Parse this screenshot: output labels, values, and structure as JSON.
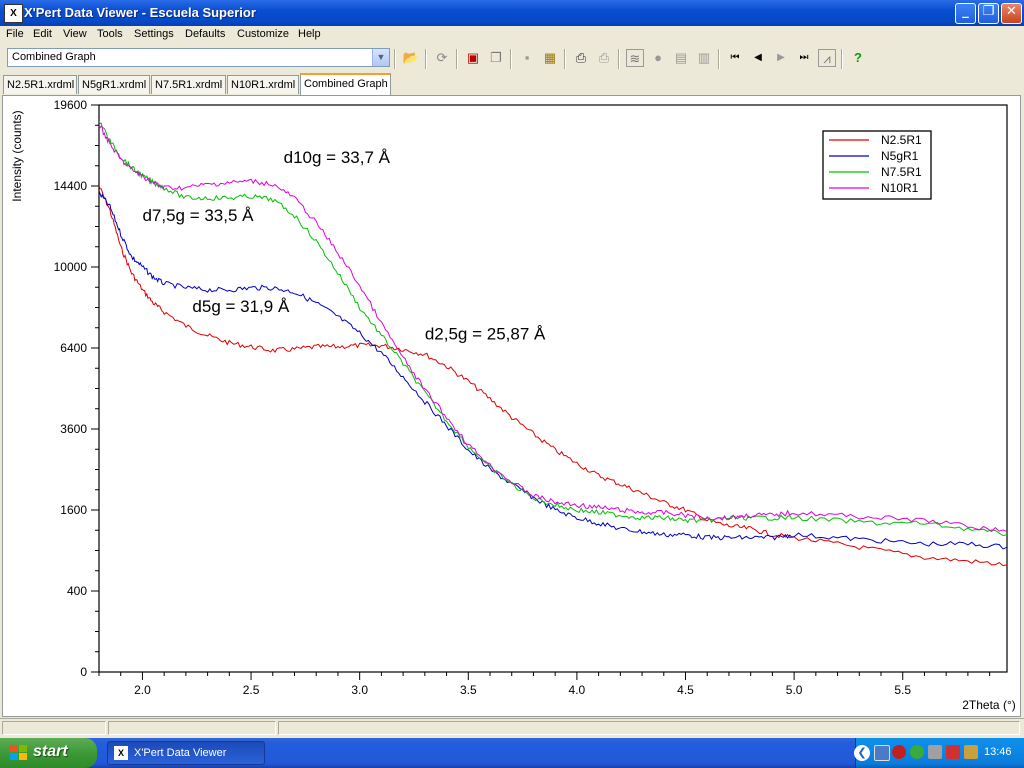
{
  "window": {
    "title": "X'Pert Data Viewer - Escuela Superior",
    "app_icon_label": "X"
  },
  "caption_buttons": {
    "minimize": "_",
    "restore": "❐",
    "close": "✕"
  },
  "menu": [
    "File",
    "Edit",
    "View",
    "Tools",
    "Settings",
    "Defaults",
    "Customize",
    "Help"
  ],
  "toolbar": {
    "graph_select_value": "Combined Graph",
    "icons": [
      "open-folder-icon",
      "refresh-icon",
      "print-preview-icon",
      "copy-icon",
      "camera-icon",
      "clipboard-icon",
      "printer-icon",
      "printer-gray-icon",
      "graph-icon",
      "record-icon",
      "document-icon",
      "page-icon",
      "first-icon",
      "previous-icon",
      "next-icon",
      "last-icon",
      "chart-icon",
      "help-icon"
    ]
  },
  "tabs": [
    {
      "label": "N2.5R1.xrdml",
      "active": false
    },
    {
      "label": "N5gR1.xrdml",
      "active": false
    },
    {
      "label": "N7.5R1.xrdml",
      "active": false
    },
    {
      "label": "N10R1.xrdml",
      "active": false
    },
    {
      "label": "Combined Graph",
      "active": true
    }
  ],
  "chart_data": {
    "type": "line",
    "xlabel": "2Theta (°)",
    "ylabel": "Intensity (counts)",
    "xlim": [
      1.8,
      5.98
    ],
    "y_scale": "sqrt",
    "ylim": [
      0,
      19600
    ],
    "x_ticks": [
      "2.0",
      "2.5",
      "3.0",
      "3.5",
      "4.0",
      "4.5",
      "5.0",
      "5.5"
    ],
    "y_ticks": [
      "0",
      "400",
      "1600",
      "3600",
      "6400",
      "10000",
      "14400",
      "19600"
    ],
    "legend_position": "top-right",
    "grid": false,
    "series": [
      {
        "name": "N2.5R1",
        "color": "#E00000",
        "x": [
          1.8,
          1.85,
          1.9,
          1.95,
          2.0,
          2.05,
          2.1,
          2.2,
          2.3,
          2.4,
          2.5,
          2.6,
          2.7,
          2.8,
          2.9,
          3.0,
          3.1,
          3.2,
          3.3,
          3.4,
          3.5,
          3.6,
          3.7,
          3.8,
          3.9,
          4.0,
          4.1,
          4.2,
          4.3,
          4.4,
          4.5,
          4.6,
          4.7,
          4.8,
          4.9,
          5.0,
          5.2,
          5.4,
          5.6,
          5.8,
          5.98
        ],
        "y": [
          14400,
          13000,
          11000,
          9700,
          8900,
          8300,
          7900,
          7300,
          6900,
          6600,
          6450,
          6300,
          6350,
          6450,
          6450,
          6500,
          6500,
          6350,
          6150,
          5700,
          5150,
          4550,
          3950,
          3450,
          3000,
          2650,
          2350,
          2150,
          1950,
          1750,
          1600,
          1400,
          1300,
          1250,
          1150,
          1100,
          1000,
          900,
          800,
          750,
          700
        ]
      },
      {
        "name": "N5gR1",
        "color": "#0000C0",
        "x": [
          1.8,
          1.85,
          1.9,
          1.95,
          2.0,
          2.05,
          2.1,
          2.2,
          2.3,
          2.4,
          2.5,
          2.6,
          2.7,
          2.8,
          2.9,
          3.0,
          3.1,
          3.2,
          3.3,
          3.4,
          3.5,
          3.6,
          3.7,
          3.8,
          3.9,
          4.0,
          4.1,
          4.2,
          4.3,
          4.4,
          4.5,
          4.6,
          4.7,
          4.8,
          4.9,
          5.0,
          5.2,
          5.4,
          5.6,
          5.8,
          5.98
        ],
        "y": [
          14000,
          13200,
          11700,
          10500,
          10000,
          9500,
          9200,
          9000,
          8900,
          8900,
          9000,
          9000,
          8800,
          8300,
          7700,
          7000,
          6200,
          5300,
          4450,
          3700,
          3000,
          2500,
          2150,
          1850,
          1600,
          1450,
          1350,
          1250,
          1200,
          1150,
          1150,
          1100,
          1100,
          1100,
          1100,
          1150,
          1100,
          1050,
          1000,
          1000,
          950
        ]
      },
      {
        "name": "N7.5R1",
        "color": "#00C000",
        "x": [
          1.8,
          1.85,
          1.9,
          1.95,
          2.0,
          2.05,
          2.1,
          2.2,
          2.3,
          2.4,
          2.5,
          2.6,
          2.7,
          2.8,
          2.9,
          3.0,
          3.1,
          3.2,
          3.3,
          3.4,
          3.5,
          3.6,
          3.7,
          3.8,
          3.9,
          4.0,
          4.1,
          4.2,
          4.3,
          4.4,
          4.5,
          4.6,
          4.7,
          4.8,
          4.9,
          5.0,
          5.2,
          5.4,
          5.6,
          5.8,
          5.98
        ],
        "y": [
          18600,
          17200,
          16200,
          15500,
          15000,
          14600,
          14300,
          13700,
          13700,
          13700,
          13800,
          13600,
          12700,
          11300,
          9700,
          8100,
          6900,
          5800,
          4750,
          3850,
          3100,
          2550,
          2150,
          1850,
          1700,
          1600,
          1550,
          1500,
          1450,
          1450,
          1400,
          1400,
          1450,
          1450,
          1450,
          1450,
          1400,
          1350,
          1350,
          1250,
          1150
        ]
      },
      {
        "name": "N10R1",
        "color": "#E000E0",
        "x": [
          1.8,
          1.85,
          1.9,
          1.95,
          2.0,
          2.05,
          2.1,
          2.2,
          2.3,
          2.4,
          2.5,
          2.6,
          2.7,
          2.8,
          2.9,
          3.0,
          3.1,
          3.2,
          3.3,
          3.4,
          3.5,
          3.6,
          3.7,
          3.8,
          3.9,
          4.0,
          4.1,
          4.2,
          4.3,
          4.4,
          4.5,
          4.6,
          4.7,
          4.8,
          4.9,
          5.0,
          5.2,
          5.4,
          5.6,
          5.8,
          5.98
        ],
        "y": [
          18300,
          17000,
          16000,
          15400,
          15000,
          14600,
          14300,
          14300,
          14500,
          14600,
          14700,
          14500,
          13700,
          12300,
          10700,
          9100,
          7400,
          6000,
          4850,
          3950,
          3150,
          2600,
          2200,
          1900,
          1750,
          1700,
          1650,
          1600,
          1550,
          1550,
          1500,
          1450,
          1450,
          1500,
          1500,
          1550,
          1500,
          1450,
          1400,
          1300,
          1200
        ]
      }
    ],
    "annotations": [
      {
        "text": "d10g = 33,7 Å",
        "x": 2.65,
        "y": 15800
      },
      {
        "text": "d7,5g = 33,5 Å",
        "x": 2.0,
        "y": 12400
      },
      {
        "text": "d5g = 31,9 Å",
        "x": 2.23,
        "y": 7900
      },
      {
        "text": "d2,5g = 25,87 Å",
        "x": 3.3,
        "y": 6750
      }
    ]
  },
  "taskbar": {
    "start_label": "start",
    "task_label": "X'Pert Data Viewer",
    "task_icon_label": "X",
    "clock": "13:46",
    "tray_chevron": "❮"
  }
}
